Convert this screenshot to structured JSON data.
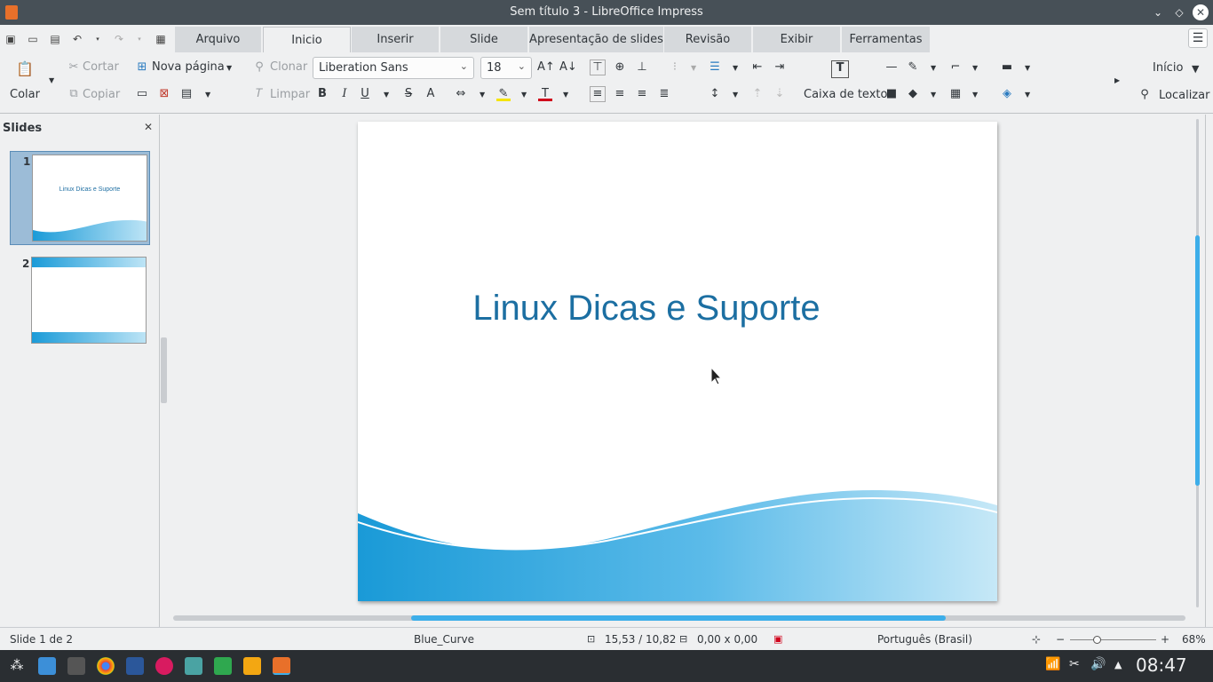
{
  "window": {
    "title": "Sem título 3 - LibreOffice Impress"
  },
  "tabs": [
    "Arquivo",
    "Inicio",
    "Inserir",
    "Slide",
    "Apresentação de slides",
    "Revisão",
    "Exibir",
    "Ferramentas"
  ],
  "toolbar": {
    "paste": "Colar",
    "cut": "Cortar",
    "copy": "Copiar",
    "new_page": "Nova página",
    "clone": "Clonar",
    "clear": "Limpar",
    "font_name": "Liberation Sans",
    "font_size": "18",
    "textbox": "Caixa de texto",
    "home": "Início",
    "find": "Localizar"
  },
  "sidebar": {
    "title": "Slides",
    "slides": [
      {
        "number": "1",
        "text": "Linux Dicas e Suporte"
      },
      {
        "number": "2",
        "text": ""
      }
    ]
  },
  "slide": {
    "title": "Linux Dicas e Suporte"
  },
  "statusbar": {
    "slide_info": "Slide 1 de 2",
    "master": "Blue_Curve",
    "position": "15,53 / 10,82",
    "size": "0,00 x 0,00",
    "language": "Português (Brasil)",
    "zoom": "68%",
    "zoom_minus": "−",
    "zoom_plus": "+"
  },
  "taskbar": {
    "time": "08:47"
  },
  "colors": {
    "accent": "#3daee9",
    "slide_title": "#1c6fa2",
    "titlebar": "#475057"
  }
}
